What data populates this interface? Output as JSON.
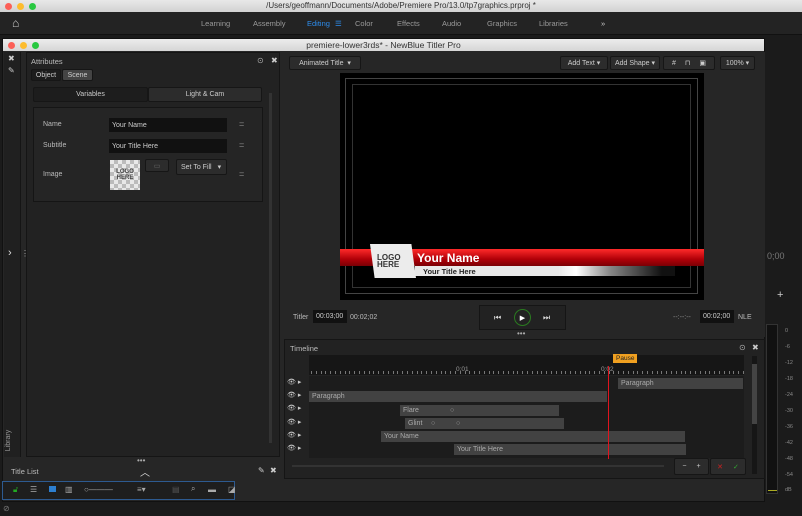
{
  "os": {
    "title": "/Users/geoffmann/Documents/Adobe/Premiere Pro/13.0/tp7graphics.prproj *"
  },
  "workspaces": {
    "items": [
      "Learning",
      "Assembly",
      "Editing",
      "Color",
      "Effects",
      "Audio",
      "Graphics",
      "Libraries"
    ],
    "active": "Editing",
    "more": "»"
  },
  "titler": {
    "title": "premiere-lower3rds* - NewBlue Titler Pro"
  },
  "attributes": {
    "title": "Attributes",
    "tabs": [
      "Object",
      "Scene"
    ],
    "subtabs": [
      "Variables",
      "Light & Cam"
    ],
    "name_label": "Name",
    "name_value": "Your Name",
    "subtitle_label": "Subtitle",
    "subtitle_value": "Your Title Here",
    "image_label": "Image",
    "image_thumb": "LOGO HERE",
    "fill_option": "Set To Fill"
  },
  "library": "Library",
  "title_list": {
    "title": "Title List"
  },
  "toolbar": {
    "animated_title": "Animated Title",
    "add_text": "Add Text",
    "add_shape": "Add Shape",
    "zoom": "100%"
  },
  "preview": {
    "logo": "LOGO HERE",
    "name": "Your Name",
    "subtitle": "Your Title Here"
  },
  "transport": {
    "titler_label": "Titler",
    "titler_duration": "00:03;00",
    "current_time": "00:02;02",
    "in_point": "--:--:--",
    "nle_duration": "00:02;00",
    "nle_label": "NLE"
  },
  "timeline": {
    "title": "Timeline",
    "marker": "Pause",
    "ruler": [
      "0:01",
      "0:02"
    ],
    "tracks": [
      {
        "label": "Paragraph"
      },
      {
        "label": "Paragraph"
      },
      {
        "label": "Flare"
      },
      {
        "label": "Glint"
      },
      {
        "label": "Your Name"
      },
      {
        "label": "Your Title Here"
      }
    ],
    "minus": "−",
    "plus": "+"
  },
  "premiere": {
    "timecode": "0;00",
    "add": "+",
    "meter": [
      "0",
      "-6",
      "-12",
      "-18",
      "-24",
      "-30",
      "-36",
      "-42",
      "-48",
      "-54",
      "dB"
    ]
  },
  "colors": {
    "accent": "#2d8ceb",
    "marker": "#f0a020",
    "playhead": "#e0141e",
    "lower_third": "#d0000a"
  }
}
